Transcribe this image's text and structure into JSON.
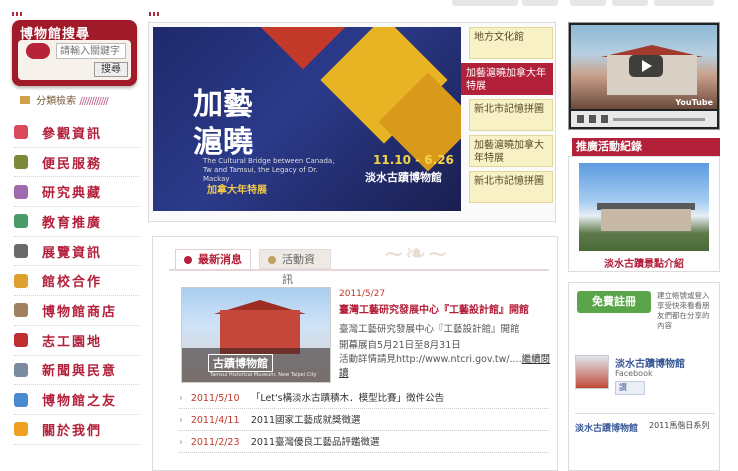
{
  "search": {
    "title": "博物館搜尋",
    "placeholder": "請輸入關鍵字",
    "button": "搜尋"
  },
  "category_search": {
    "label": "分類檢索",
    "decor": "////////////"
  },
  "nav": [
    {
      "label": "參觀資訊",
      "icon": "visitor-icon",
      "color": "#d94a5a"
    },
    {
      "label": "便民服務",
      "icon": "service-icon",
      "color": "#7a8a3a"
    },
    {
      "label": "研究典藏",
      "icon": "collection-icon",
      "color": "#a06ab0"
    },
    {
      "label": "教育推廣",
      "icon": "education-icon",
      "color": "#4a9a6a"
    },
    {
      "label": "展覽資訊",
      "icon": "exhibition-icon",
      "color": "#6a6a6a"
    },
    {
      "label": "館校合作",
      "icon": "partnership-icon",
      "color": "#e0a030"
    },
    {
      "label": "博物館商店",
      "icon": "shop-icon",
      "color": "#a08060"
    },
    {
      "label": "志工園地",
      "icon": "volunteer-icon",
      "color": "#c03030"
    },
    {
      "label": "新聞與民意",
      "icon": "news-icon",
      "color": "#7a8aa0"
    },
    {
      "label": "博物館之友",
      "icon": "friends-icon",
      "color": "#4a8ad0"
    },
    {
      "label": "關於我們",
      "icon": "info-icon",
      "color": "#f0a020"
    }
  ],
  "banner": {
    "title_line1": "加藝",
    "title_line2": "滬曉",
    "subtitle": "The Cultural Bridge between Canada, Tw and Tamsui, the Legacy of Dr. Mackay",
    "special": "加拿大年特展",
    "dates": "11.10 - 6.26",
    "venue": "淡水古蹟博物館",
    "tabs": [
      {
        "label": "地方文化館",
        "active": false
      },
      {
        "label": "加藝滬曉加拿大年特展",
        "active": true
      },
      {
        "label": "新北市記憶拼圖",
        "active": false
      },
      {
        "label": "加藝滬曉加拿大年特展",
        "active": false
      },
      {
        "label": "新北市記憶拼圖",
        "active": false
      }
    ]
  },
  "news": {
    "tab_news": "最新消息",
    "tab_events": "活動資訊",
    "featured": {
      "image_caption": "古蹟博物館",
      "image_caption_en": "Tamsui Historical Museum, New Taipei City",
      "date": "2011/5/27",
      "headline": "臺灣工藝研究發展中心『工藝設計館』開館",
      "body1": "臺灣工藝研究發展中心『工藝設計館』開館",
      "body2": "開幕展自5月21日至8月31日",
      "body3": "活動詳情請見http://www.ntcri.gov.tw/....",
      "more": "繼續閱讀"
    },
    "items": [
      {
        "date": "2011/5/10",
        "title": "「Let's構淡水古蹟積木．模型比賽」徵件公告"
      },
      {
        "date": "2011/4/11",
        "title": "2011國家工藝成就獎徵選"
      },
      {
        "date": "2011/2/23",
        "title": "2011臺灣優良工藝品評鑑徵選"
      }
    ]
  },
  "video": {
    "logo": "YouTube"
  },
  "promo": {
    "header": "推廣活動紀錄",
    "caption": "淡水古蹟景點介紹"
  },
  "facebook": {
    "signup": "免費註冊",
    "note": "建立帳號或登入享受快來看看朋友們都在分享的內容",
    "page_name": "淡水古蹟博物館",
    "platform": "Facebook",
    "like": "讚",
    "post_name": "淡水古蹟博物館",
    "post_text": "2011馬偕日系列"
  }
}
